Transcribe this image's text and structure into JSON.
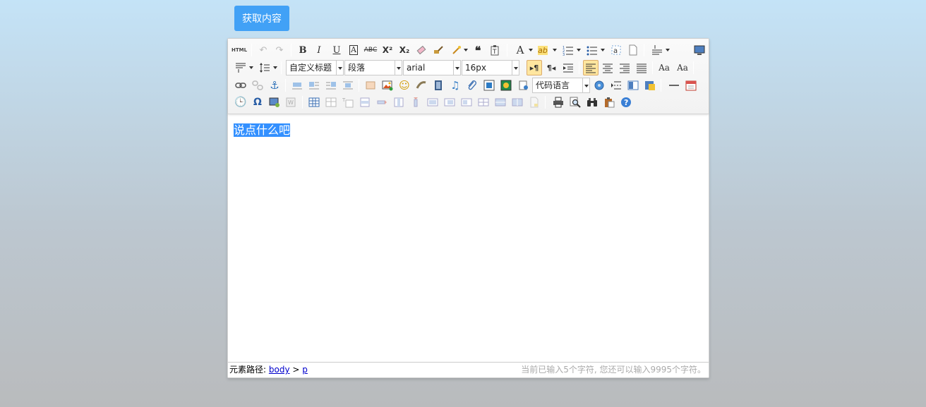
{
  "get_button": {
    "label": "获取内容"
  },
  "toolbar": {
    "html_label": "HTML",
    "customstyle": "自定义标题",
    "paragraph": "段落",
    "fontfamily": "arial",
    "fontsize": "16px",
    "codelang": "代码语言"
  },
  "content": {
    "text": "说点什么吧"
  },
  "statusbar": {
    "path_label": "元素路径:",
    "path_body": "body",
    "path_sep": ">",
    "path_p": "p",
    "word_count": "当前已输入5个字符, 您还可以输入9995个字符。"
  },
  "colors": {
    "button": "#41a1f6",
    "selection": "#3390ff",
    "active_button": "#ffe69f"
  }
}
